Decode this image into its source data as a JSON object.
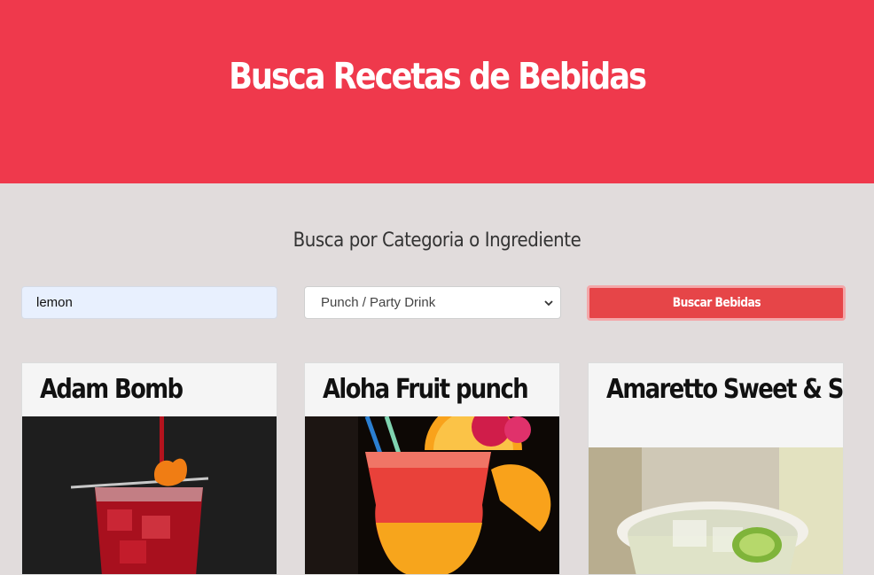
{
  "header": {
    "title": "Busca Recetas de Bebidas",
    "background_color": "#ef394c"
  },
  "search": {
    "subtitle": "Busca por Categoria o Ingrediente",
    "input_value": "lemon",
    "category_selected": "Punch / Party Drink",
    "button_label": "Buscar Bebidas",
    "button_color": "#e64548"
  },
  "results": [
    {
      "name": "Adam Bomb",
      "image_icon": "drink-photo"
    },
    {
      "name": "Aloha Fruit punch",
      "image_icon": "drink-photo"
    },
    {
      "name": "Amaretto Sweet & Sour",
      "image_icon": "drink-photo"
    }
  ]
}
